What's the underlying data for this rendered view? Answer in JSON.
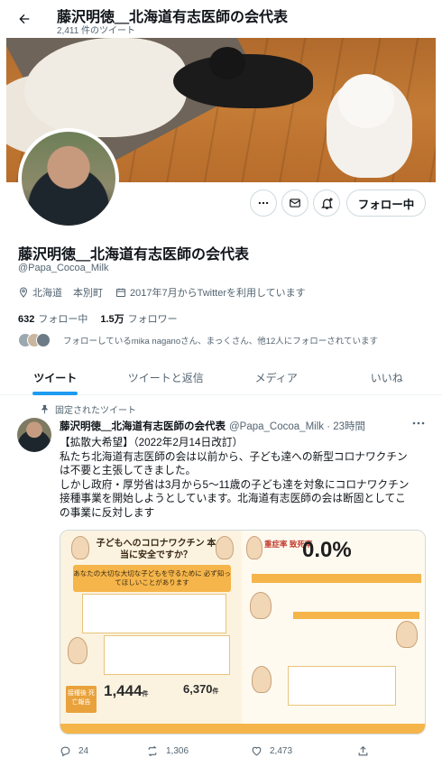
{
  "header": {
    "title": "藤沢明徳＿北海道有志医師の会代表",
    "tweet_count": "2,411 件のツイート"
  },
  "profile": {
    "name": "藤沢明徳＿北海道有志医師の会代表",
    "handle": "@Papa_Cocoa_Milk",
    "location": "北海道",
    "location2": "本別町",
    "joined": "2017年7月からTwitterを利用しています",
    "following_count": "632",
    "following_label": "フォロー中",
    "followers_count": "1.5万",
    "followers_label": "フォロワー",
    "followed_by": "フォローしているmika naganoさん、まっくさん、他12人にフォローされています",
    "follow_button": "フォロー中"
  },
  "tabs": [
    {
      "label": "ツイート",
      "active": true
    },
    {
      "label": "ツイートと返信",
      "active": false
    },
    {
      "label": "メディア",
      "active": false
    },
    {
      "label": "いいね",
      "active": false
    }
  ],
  "tweet": {
    "pinned_label": "固定されたツイート",
    "author_name": "藤沢明徳＿北海道有志医師の会代表",
    "author_handle_time": "@Papa_Cocoa_Milk · 23時間",
    "lines": [
      "【拡散大希望】（2022年2月14日改訂）",
      "私たち北海道有志医師の会は以前から、子ども達への新型コロナワクチン",
      "は不要と主張してきました。",
      "しかし政府・厚労省は3月から5～11歳の子ども達を対象にコロナワクチン",
      "接種事業を開始しようとしています。北海道有志医師の会は断固としてこ",
      "の事業に反対します"
    ],
    "media": {
      "title": "子どもへのコロナワクチン 本当に安全ですか？",
      "band_text": "あなたの大切な大切な子どもを守るために 必ず知ってほしいことがあります",
      "stat_label": "接種後 死亡報告",
      "stat1": "1,444",
      "stat1_unit": "件",
      "stat2": "6,370",
      "stat2_unit": "件",
      "big_label": "重症率 致死率",
      "big_value": "0.0%"
    },
    "replies": "24",
    "retweets": "1,306",
    "likes": "2,473"
  },
  "colors": {
    "accent": "#1d9bf0",
    "text": "#0f1419",
    "muted": "#536471",
    "border": "#cfd9de",
    "flyer_orange": "#f5b54a"
  }
}
